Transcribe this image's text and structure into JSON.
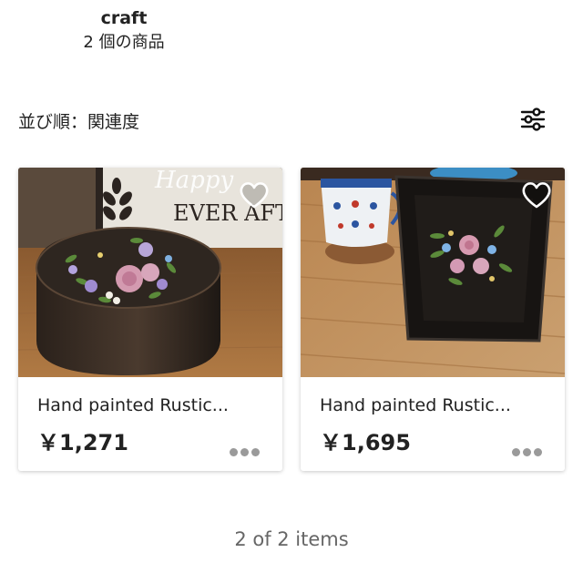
{
  "search": {
    "title": "craft",
    "result_count": "2 個の商品"
  },
  "sort": {
    "label": "並び順：関連度"
  },
  "products": [
    {
      "name": "Hand painted  Rustic...",
      "price": "￥1,271"
    },
    {
      "name": "Hand painted  Rustic...",
      "price": "￥1,695"
    }
  ],
  "photo_texts": {
    "sign_script": "Happy",
    "sign_text": "EVER AFTER"
  },
  "pagination": {
    "text": "2 of 2 items"
  },
  "icons": {
    "filter": "sliders-icon",
    "favorite": "heart-outline-icon",
    "more": "more-horizontal-icon"
  },
  "colors": {
    "text": "#222222",
    "muted": "#666666",
    "dots": "#9a9a9a"
  }
}
